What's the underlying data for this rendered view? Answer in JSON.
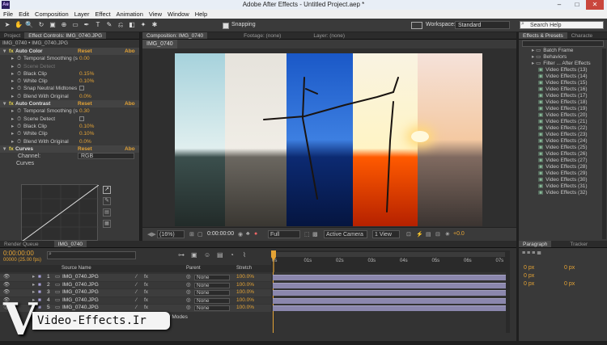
{
  "window": {
    "title": "Adobe After Effects - Untitled Project.aep *",
    "app_icon": "Ae",
    "min": "–",
    "max": "□",
    "close": "✕"
  },
  "menu": [
    "File",
    "Edit",
    "Composition",
    "Layer",
    "Effect",
    "Animation",
    "View",
    "Window",
    "Help"
  ],
  "toolbar": {
    "snapping": "Snapping",
    "workspace_label": "Workspace:",
    "workspace_value": "Standard",
    "search_placeholder": "Search Help"
  },
  "left": {
    "tabs": [
      "Project",
      "Effect Controls: IMG_0740.JPG"
    ],
    "breadcrumb": "IMG_0740 • IMG_0740.JPG",
    "rows": [
      {
        "type": "fx",
        "label": "Auto Color",
        "reset": "Reset",
        "abo": "Abo"
      },
      {
        "label": "Temporal Smoothing (s",
        "val": "0.00"
      },
      {
        "label": "Scene Detect",
        "dim": true
      },
      {
        "label": "Black Clip",
        "val": "0.15%"
      },
      {
        "label": "White Clip",
        "val": "0.10%"
      },
      {
        "label": "Snap Neutral Midtones"
      },
      {
        "label": "Blend With Original",
        "val": "0.0%"
      },
      {
        "type": "fx",
        "label": "Auto Contrast",
        "reset": "Reset",
        "abo": "Abo"
      },
      {
        "label": "Temporal Smoothing (s",
        "val": "0.30"
      },
      {
        "label": "Scene Detect"
      },
      {
        "label": "Black Clip",
        "val": "0.10%"
      },
      {
        "label": "White Clip",
        "val": "0.10%"
      },
      {
        "label": "Blend With Original",
        "val": "0.0%"
      },
      {
        "type": "fx",
        "label": "Curves",
        "reset": "Reset",
        "abo": "Abo"
      }
    ],
    "channel_label": "Channel:",
    "channel_value": "RGB",
    "curves_label": "Curves"
  },
  "comp": {
    "tabs": [
      "Composition: IMG_0740",
      "Footage: (none)",
      "Layer: (none)"
    ],
    "name_tab": "IMG_0740",
    "footer": {
      "zoom": "(16%)",
      "timecode": "0:00:00:00",
      "quality": "Full",
      "camera": "Active Camera",
      "views": "1 View",
      "exposure": "+0.0"
    }
  },
  "right": {
    "tabs": [
      "Effects & Presets",
      "Characte"
    ],
    "items": [
      "Batch Frame",
      "Behaviors",
      "Filter ... After Effects",
      "Video Effects (13)",
      "Video Effects (14)",
      "Video Effects (15)",
      "Video Effects (16)",
      "Video Effects (17)",
      "Video Effects (18)",
      "Video Effects (19)",
      "Video Effects (20)",
      "Video Effects (21)",
      "Video Effects (22)",
      "Video Effects (23)",
      "Video Effects (24)",
      "Video Effects (25)",
      "Video Effects (26)",
      "Video Effects (27)",
      "Video Effects (28)",
      "Video Effects (29)",
      "Video Effects (30)",
      "Video Effects (31)",
      "Video Effects (32)"
    ]
  },
  "timeline": {
    "tabs": [
      "Render Queue",
      "IMG_0740"
    ],
    "timecode": "0:00:00:00",
    "fps": "00000 (25.00 fps)",
    "headers": {
      "source": "Source Name",
      "parent": "Parent",
      "stretch": "Stretch"
    },
    "ruler": [
      "0s",
      "01s",
      "02s",
      "03s",
      "04s",
      "05s",
      "06s",
      "07s"
    ],
    "layers": [
      {
        "n": "1",
        "name": "IMG_0740.JPG",
        "parent": "None",
        "stretch": "100.0%"
      },
      {
        "n": "2",
        "name": "IMG_0740.JPG",
        "parent": "None",
        "stretch": "100.0%"
      },
      {
        "n": "3",
        "name": "IMG_0740.JPG",
        "parent": "None",
        "stretch": "100.0%"
      },
      {
        "n": "4",
        "name": "IMG_0740.JPG",
        "parent": "None",
        "stretch": "100.0%"
      },
      {
        "n": "5",
        "name": "IMG_0740.JPG",
        "parent": "None",
        "stretch": "100.0%"
      }
    ],
    "footer": "Toggle Switches / Modes"
  },
  "paragraph": {
    "tabs": [
      "Paragraph",
      "Tracker"
    ],
    "px": [
      "0 px",
      "0 px",
      "0 px",
      "0 px",
      "0 px"
    ]
  },
  "watermark": {
    "text": "Video-Effects.Ir",
    "glyph": "V"
  }
}
